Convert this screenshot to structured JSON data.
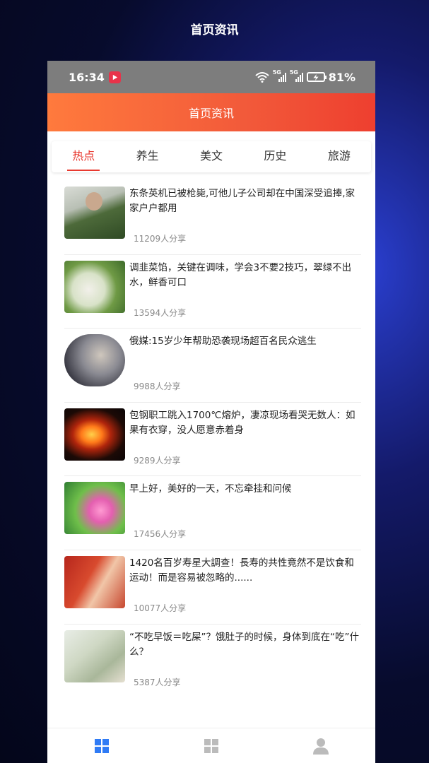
{
  "outer_title": "首页资讯",
  "status": {
    "time": "16:34",
    "battery": "81%",
    "signal_label": "5G"
  },
  "header": {
    "title": "首页资讯"
  },
  "tabs": [
    {
      "label": "热点",
      "active": true
    },
    {
      "label": "养生",
      "active": false
    },
    {
      "label": "美文",
      "active": false
    },
    {
      "label": "历史",
      "active": false
    },
    {
      "label": "旅游",
      "active": false
    }
  ],
  "articles": [
    {
      "title": "东条英机已被枪毙,可他儿子公司却在中国深受追捧,家家户户都用",
      "shares": "11209人分享"
    },
    {
      "title": "调韭菜馅，关键在调味，学会3不要2技巧，翠绿不出水，鲜香可口",
      "shares": "13594人分享"
    },
    {
      "title": "俄媒:15岁少年帮助恐袭现场超百名民众逃生",
      "shares": "9988人分享"
    },
    {
      "title": "包钢职工跳入1700℃熔炉，凄凉现场看哭无数人：如果有衣穿，没人愿意赤着身",
      "shares": "9289人分享"
    },
    {
      "title": "早上好，美好的一天，不忘牵挂和问候",
      "shares": "17456人分享"
    },
    {
      "title": "1420名百岁寿星大調查！長寿的共性竟然不是饮食和运动！而是容易被忽略的......",
      "shares": "10077人分享"
    },
    {
      "title": "“不吃早饭＝吃屎”？饿肚子的时候，身体到底在“吃”什么？",
      "shares": "5387人分享"
    }
  ],
  "bottom_nav": [
    {
      "icon": "windows-icon",
      "color": "#2f7bf5"
    },
    {
      "icon": "windows-icon",
      "color": "#bbbbbb"
    },
    {
      "icon": "user-icon",
      "color": "#bbbbbb"
    }
  ],
  "colors": {
    "accent": "#e8392f",
    "header_start": "#ff7a3d",
    "header_end": "#ee3f2f"
  }
}
